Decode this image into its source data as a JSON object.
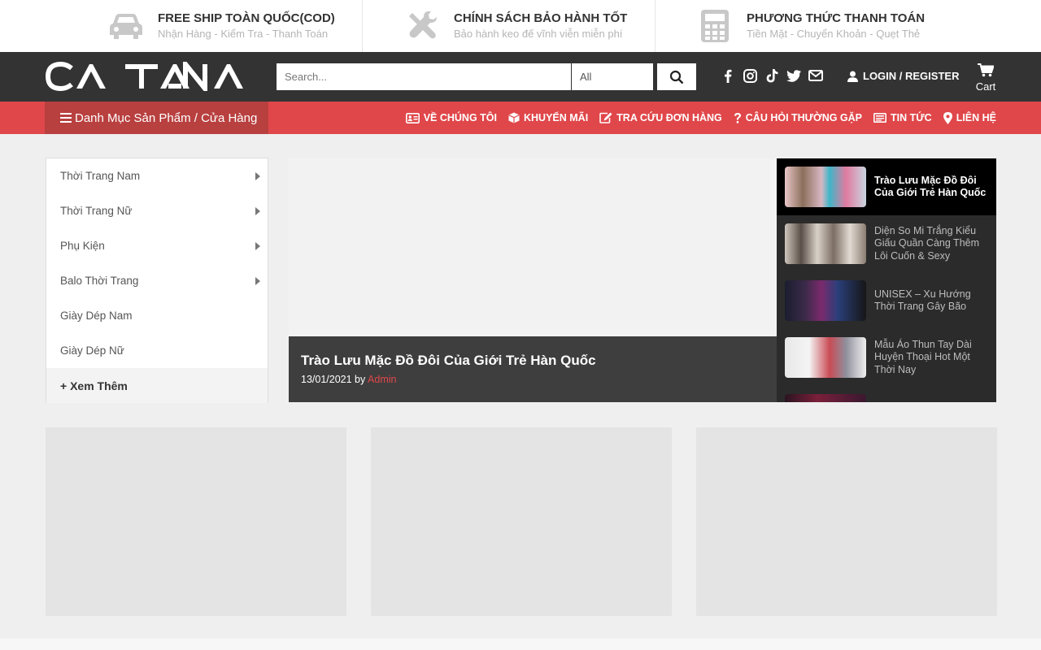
{
  "infobar": {
    "items": [
      {
        "icon": "car-icon",
        "title": "FREE SHIP TOÀN QUỐC(COD)",
        "subtitle": "Nhận Hàng - Kiểm Tra - Thanh Toán"
      },
      {
        "icon": "tools-icon",
        "title": "CHÍNH SÁCH BẢO HÀNH TỐT",
        "subtitle": "Bảo hành keo đế vĩnh viễn miễn phí"
      },
      {
        "icon": "calculator-icon",
        "title": "PHƯƠNG THỨC THANH TOÁN",
        "subtitle": "Tiền Mặt - Chuyển Khoản - Quẹt Thẻ"
      }
    ]
  },
  "header": {
    "logo": "CATANA",
    "search_placeholder": "Search...",
    "search_category": "All",
    "login_label": "LOGIN / REGISTER",
    "cart_label": "Cart"
  },
  "nav": {
    "category_toggle": "Danh Mục Sản Phẩm / Cửa Hàng",
    "items": [
      {
        "icon": "id-card-icon",
        "label": "VỀ CHÚNG TÔI"
      },
      {
        "icon": "cube-icon",
        "label": "KHUYẾN MÃI"
      },
      {
        "icon": "edit-icon",
        "label": "TRA CỨU ĐƠN HÀNG"
      },
      {
        "icon": "question-icon",
        "label": "CÂU HỎI THƯỜNG GẶP"
      },
      {
        "icon": "newspaper-icon",
        "label": "TIN TỨC"
      },
      {
        "icon": "map-marker-icon",
        "label": "LIÊN HỆ"
      }
    ]
  },
  "sidebar": {
    "items": [
      {
        "label": "Thời Trang Nam",
        "has_children": true
      },
      {
        "label": "Thời Trang Nữ",
        "has_children": true
      },
      {
        "label": "Phụ Kiện",
        "has_children": true
      },
      {
        "label": "Balo Thời Trang",
        "has_children": true
      },
      {
        "label": "Giày Dép Nam",
        "has_children": false
      },
      {
        "label": "Giày Dép Nữ",
        "has_children": false
      }
    ],
    "more_label": "+ Xem Thêm"
  },
  "slider": {
    "title": "Trào Lưu Mặc Đồ Đôi Của Giới Trẻ Hàn Quốc",
    "date": "13/01/2021",
    "by": "by",
    "author": "Admin"
  },
  "posts": [
    {
      "title": "Trào Lưu Mặc Đồ Đôi Của Giới Trẻ Hàn Quốc",
      "active": true
    },
    {
      "title": "Diện So Mi Trắng Kiểu Giấu Quần Càng Thêm Lôi Cuốn & Sexy",
      "active": false
    },
    {
      "title": "UNISEX – Xu Hướng Thời Trang Gây Bão",
      "active": false
    },
    {
      "title": "Mẫu Áo Thun Tay Dài Huyện Thoại Hot Một Thời Nay",
      "active": false
    }
  ],
  "colors": {
    "accent": "#e0474a",
    "header_bg": "#333333"
  }
}
